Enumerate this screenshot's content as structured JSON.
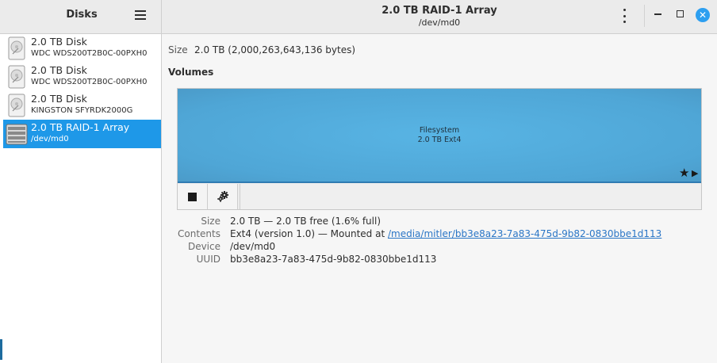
{
  "sidebar": {
    "title": "Disks",
    "devices": [
      {
        "name": "2.0 TB Disk",
        "subtitle": "WDC WDS200T2B0C-00PXH0",
        "icon": "hard-disk-icon"
      },
      {
        "name": "2.0 TB Disk",
        "subtitle": "WDC WDS200T2B0C-00PXH0",
        "icon": "hard-disk-icon"
      },
      {
        "name": "2.0 TB Disk",
        "subtitle": "KINGSTON SFYRDK2000G",
        "icon": "hard-disk-icon"
      },
      {
        "name": "2.0 TB RAID-1 Array",
        "subtitle": "/dev/md0",
        "icon": "raid-array-icon",
        "selected": true
      }
    ]
  },
  "header": {
    "title": "2.0 TB RAID-1 Array",
    "subtitle": "/dev/md0",
    "close_glyph": "✕"
  },
  "summary": {
    "size_label": "Size",
    "size_value": "2.0 TB (2,000,263,643,136 bytes)"
  },
  "volumes": {
    "heading": "Volumes",
    "partition": {
      "type": "Filesystem",
      "detail": "2.0 TB Ext4",
      "star": "★",
      "arrow": "▶"
    }
  },
  "details": {
    "size_label": "Size",
    "size_value": "2.0 TB — 2.0 TB free (1.6% full)",
    "contents_label": "Contents",
    "contents_prefix": "Ext4 (version 1.0) — Mounted at ",
    "mount_path": "/media/mitler/bb3e8a23-7a83-475d-9b82-0830bbe1d113",
    "device_label": "Device",
    "device_value": "/dev/md0",
    "uuid_label": "UUID",
    "uuid_value": "bb3e8a23-7a83-475d-9b82-0830bbe1d113"
  },
  "colors": {
    "accent": "#1e98e8",
    "partition": "#58b4e4",
    "link": "#2a76c6"
  }
}
